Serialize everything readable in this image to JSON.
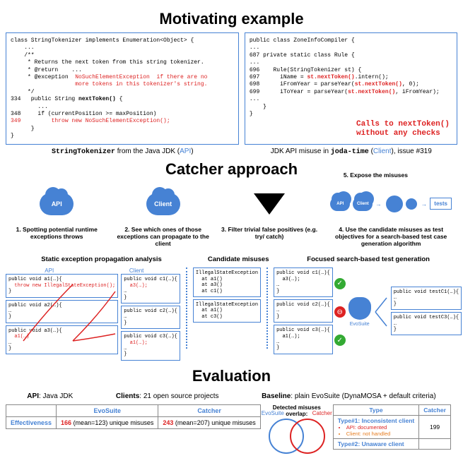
{
  "titles": {
    "motivating": "Motivating example",
    "catcher": "Catcher approach",
    "evaluation": "Evaluation"
  },
  "code_left": {
    "l1": "class StringTokenizer implements Enumeration<Object> {",
    "l2": "    ...",
    "l3": "    /**",
    "l4": "     * Returns the next token from this string tokenizer.",
    "l5": "     * @return    ...",
    "l6a": "     * @exception  ",
    "l6b": "NoSuchElementException  if there are no",
    "l7": "                   more tokens in this tokenizer's string.",
    "l8": "     */",
    "l9a": "334   public String ",
    "l9b": "nextToken()",
    "l9c": " {",
    "l10": "        ...",
    "l11": "348     if (currentPosition >= maxPosition)",
    "l12": "349         throw new NoSuchElementException();",
    "l13": "      }",
    "l14": "}"
  },
  "code_right": {
    "l1": "public class ZoneInfoCompiler {",
    "l2": "...",
    "l3": "687 private static class Rule {",
    "l4": "...",
    "l5": "696    Rule(StringTokenizer st) {",
    "l6a": "697      iName = ",
    "l6b": "st.nextToken()",
    "l6c": ".intern();",
    "l7a": "698      iFromYear = parseYear(",
    "l7b": "st.nextToken()",
    "l7c": ", 0);",
    "l8a": "699      iToYear = parseYear(",
    "l8b": "st.nextToken()",
    "l8c": ", iFromYear);",
    "l9": "...",
    "l10": "    }",
    "l11": "}",
    "callout1": "Calls to nextToken()",
    "callout2": "without any checks"
  },
  "captions": {
    "left_a": "StringTokenizer",
    "left_b": " from the Java JDK (",
    "left_c": "API",
    "left_d": ")",
    "right_a": "JDK API misuse in ",
    "right_b": "joda-time",
    "right_c": " (",
    "right_d": "Client",
    "right_e": "), issue #319"
  },
  "steps": {
    "s1": "1. Spotting potential runtime exceptions throws",
    "s2": "2. See which ones of those exceptions can propagate to the client",
    "s3": "3. Filter trivial false positives (e.g. try/ catch)",
    "s4": "4. Use the candidate misuses as test objectives for a search-based test case generation algorithm",
    "s5": "5. Expose the misuses",
    "api": "API",
    "client": "Client",
    "tests": "tests"
  },
  "subheaders": {
    "h1": "Static exception propagation analysis",
    "h2": "Candidate misuses",
    "h3": "Focused search-based test generation"
  },
  "static_analysis": {
    "api_label": "API",
    "client_label": "Client",
    "a1": "public void a1(…){",
    "a1_throw": "  throw new IllegalStateException();",
    "a1_end": "}",
    "a2": "public void a2(…){",
    "a2_end": "…\n}",
    "a3": "public void a3(…){",
    "a3_call": "  a1(…)",
    "a3_end": "…\n}",
    "c1": "public void c1(…){",
    "c1_call": "  a3(…);",
    "c1_end": "…\n}",
    "c2": "public void c2(…){",
    "c2_end": "…\n}",
    "c3": "public void c3(…){",
    "c3_call": "  a1(…);",
    "c3_end": "…\n}"
  },
  "candidates": {
    "b1_l1": "IllegalStateException",
    "b1_l2": "  at a1()",
    "b1_l3": "  at a3()",
    "b1_l4": "  at c1()",
    "b2_l1": "IllegalStateException",
    "b2_l2": "  at a1()",
    "b2_l3": "  at c3()"
  },
  "focused": {
    "c1": "public void c1(…){",
    "c1_call": "  a3(…);",
    "c1_end": "…\n}",
    "c2": "public void c2(…){",
    "c2_end": "…\n}",
    "c3": "public void c3(…){",
    "c3_call": "  a1(…);",
    "c3_end": "…\n}",
    "evo": "EvoSuite",
    "t1": "public void testC1(…){",
    "t1_end": "…\n}",
    "t3": "public void testC3(…){",
    "t3_end": "…\n}"
  },
  "eval": {
    "api_lbl": "API",
    "api_val": ": Java JDK",
    "clients_lbl": "Clients",
    "clients_val": ": 21 open source projects",
    "baseline_lbl": "Baseline",
    "baseline_val": ": plain EvoSuite (DynaMOSA + default criteria)",
    "tbl_h1": "EvoSuite",
    "tbl_h2": "Catcher",
    "row1_label": "Effectiveness",
    "row1_evo_n": "166",
    "row1_evo_t": " (mean=123) unique misuses",
    "row1_cat_n": "243",
    "row1_cat_t": " (mean=207) unique misuses",
    "venn_title": "Detected misuses overlap:",
    "venn_l": "EvoSuite",
    "venn_r": "Catcher",
    "type_h1": "Type",
    "type_h2": "Catcher",
    "type1": "Type#1: Inconsistent client",
    "type1_a": "API: documented",
    "type1_b": "Client: not handled",
    "type1_val": "199",
    "type2": "Type#2: Unaware client"
  }
}
